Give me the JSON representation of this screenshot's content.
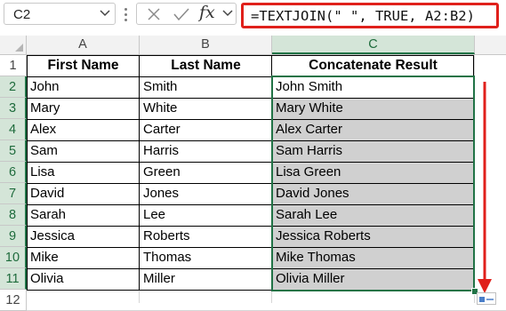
{
  "formula_bar": {
    "name_box": "C2",
    "formula": "=TEXTJOIN(\" \", TRUE, A2:B2)",
    "icons": [
      "chevron-down-icon",
      "cancel-x-icon",
      "enter-check-icon",
      "insert-function-icon"
    ],
    "fx_label": "fx"
  },
  "columns": [
    "A",
    "B",
    "C"
  ],
  "selected_column": "C",
  "rows": [
    "1",
    "2",
    "3",
    "4",
    "5",
    "6",
    "7",
    "8",
    "9",
    "10",
    "11",
    "12"
  ],
  "table": {
    "headers": [
      "First Name",
      "Last Name",
      "Concatenate Result"
    ],
    "data": [
      [
        "John",
        "Smith",
        "John Smith"
      ],
      [
        "Mary",
        "White",
        "Mary White"
      ],
      [
        "Alex",
        "Carter",
        "Alex Carter"
      ],
      [
        "Sam",
        "Harris",
        "Sam Harris"
      ],
      [
        "Lisa",
        "Green",
        "Lisa Green"
      ],
      [
        "David",
        "Jones",
        "David Jones"
      ],
      [
        "Sarah",
        "Lee",
        "Sarah Lee"
      ],
      [
        "Jessica",
        "Roberts",
        "Jessica Roberts"
      ],
      [
        "Mike",
        "Thomas",
        "Mike Thomas"
      ],
      [
        "Olivia",
        "Miller",
        "Olivia Miller"
      ]
    ]
  },
  "colors": {
    "accent_green": "#217346",
    "highlight_red": "#e0201b",
    "fill_gray": "#d0d0d0",
    "header_bg": "#f2f2f2"
  }
}
